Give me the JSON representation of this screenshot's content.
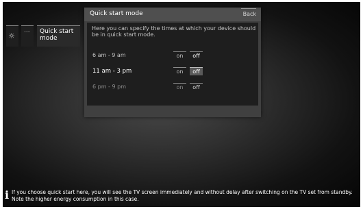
{
  "sidebar": {
    "settings_icon": "gear-icon",
    "more_label": "...",
    "quick_start_label": "Quick start mode"
  },
  "panel": {
    "title": "Quick start mode",
    "back_label": "Back",
    "description": "Here you can specify the times at which your device should be in quick start mode.",
    "rows": [
      {
        "label": "6 am - 9 am",
        "on_label": "on",
        "off_label": "off",
        "selected": "off"
      },
      {
        "label": "11 am - 3 pm",
        "on_label": "on",
        "off_label": "off",
        "selected": "off"
      },
      {
        "label": "6 pm - 9 pm",
        "on_label": "on",
        "off_label": "off",
        "selected": "off"
      }
    ]
  },
  "info": {
    "icon": "info-icon",
    "text": "If you choose quick start here, you will see the TV screen immediately and without delay after switching on the TV set from standby. Note the higher energy consumption in this case."
  }
}
